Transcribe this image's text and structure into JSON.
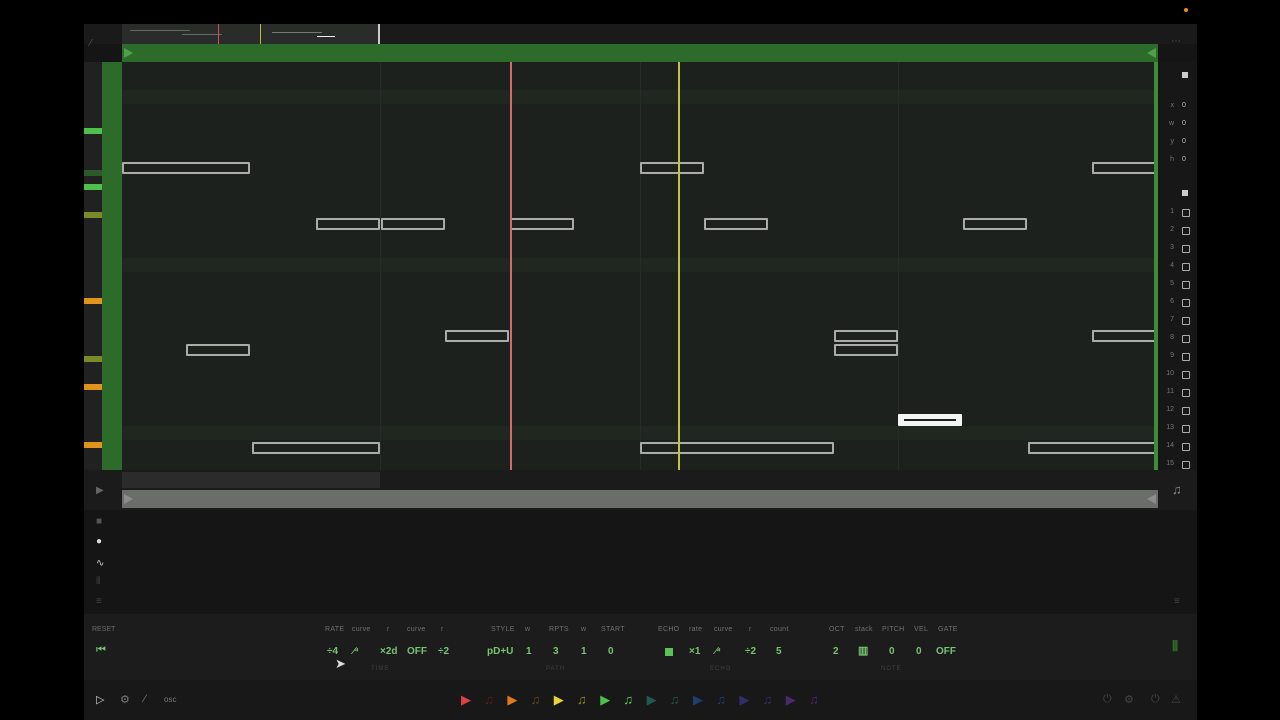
{
  "colors": {
    "loop_green": "#2d6b2a",
    "accent_green": "#79c274",
    "playhead_red": "#d46a6a",
    "playhead_yellow": "#c4c14a",
    "note_outline": "#a9aca9",
    "key_green": "#4fc04c",
    "key_orange": "#e0941d",
    "key_olive": "#7d8a2a"
  },
  "right_panel": {
    "xy_values": [
      "0",
      "0",
      "0",
      "0"
    ],
    "xy_labels": [
      "x",
      "w",
      "y",
      "h"
    ],
    "rows": [
      "1",
      "2",
      "3",
      "4",
      "5",
      "6",
      "7",
      "8",
      "9",
      "10",
      "11",
      "12",
      "13",
      "14",
      "15"
    ]
  },
  "params": {
    "reset_label": "RESET",
    "labels": [
      {
        "key": "rate",
        "text": "RATE"
      },
      {
        "key": "curve1",
        "text": "curve"
      },
      {
        "key": "r1",
        "text": "r"
      },
      {
        "key": "curve2",
        "text": "curve"
      },
      {
        "key": "r2",
        "text": "r"
      },
      {
        "key": "style",
        "text": "STYLE"
      },
      {
        "key": "w1",
        "text": "w"
      },
      {
        "key": "rpts",
        "text": "RPTS"
      },
      {
        "key": "w2",
        "text": "w"
      },
      {
        "key": "start",
        "text": "START"
      },
      {
        "key": "echo",
        "text": "ECHO"
      },
      {
        "key": "rate2",
        "text": "rate"
      },
      {
        "key": "curve3",
        "text": "curve"
      },
      {
        "key": "r3",
        "text": "r"
      },
      {
        "key": "count",
        "text": "count"
      },
      {
        "key": "oct",
        "text": "OCT"
      },
      {
        "key": "stack",
        "text": "stack"
      },
      {
        "key": "pitch",
        "text": "PITCH"
      },
      {
        "key": "vel",
        "text": "VEL"
      },
      {
        "key": "gate",
        "text": "GATE"
      }
    ],
    "values": {
      "rate": "÷4",
      "curve1": "∕⁴",
      "r1": "×2d",
      "curve2": "OFF",
      "r2": "÷2",
      "style": "pD+U",
      "w1": "1",
      "rpts": "3",
      "w2": "1",
      "start": "0",
      "echo_rate": "×1",
      "curve3": "∕⁴",
      "r3": "÷2",
      "count": "5",
      "oct": "2",
      "pitch": "0",
      "vel": "0",
      "gate": "OFF"
    },
    "sections": {
      "time": "TIME",
      "path": "PATH",
      "echo": "ECHO",
      "note": "NOTE"
    }
  },
  "transport": {
    "left_label": "osc",
    "buttons": [
      {
        "name": "red-play",
        "glyph": "▶",
        "color": "#e04040"
      },
      {
        "name": "red-note",
        "glyph": "♫",
        "color": "#5a1f1f"
      },
      {
        "name": "orange-play",
        "glyph": "▶",
        "color": "#e07a20"
      },
      {
        "name": "orange-note",
        "glyph": "♫",
        "color": "#6a4418"
      },
      {
        "name": "yellow-play",
        "glyph": "▶",
        "color": "#e8d23a"
      },
      {
        "name": "yellow-note",
        "glyph": "♫",
        "color": "#8f8a2c"
      },
      {
        "name": "green-play",
        "glyph": "▶",
        "color": "#4fc04c"
      },
      {
        "name": "green-note",
        "glyph": "♫",
        "color": "#5fd05c"
      },
      {
        "name": "teal-play",
        "glyph": "▶",
        "color": "#1f5a50"
      },
      {
        "name": "teal-note",
        "glyph": "♫",
        "color": "#1f5a50"
      },
      {
        "name": "blue-play",
        "glyph": "▶",
        "color": "#1f3f6a"
      },
      {
        "name": "blue-note",
        "glyph": "♫",
        "color": "#1f3f6a"
      },
      {
        "name": "indigo-play",
        "glyph": "▶",
        "color": "#2f2f6a"
      },
      {
        "name": "indigo-note",
        "glyph": "♫",
        "color": "#2f2f6a"
      },
      {
        "name": "violet-play",
        "glyph": "▶",
        "color": "#4a2a6a"
      },
      {
        "name": "violet-note",
        "glyph": "♫",
        "color": "#4a2a6a"
      }
    ]
  }
}
